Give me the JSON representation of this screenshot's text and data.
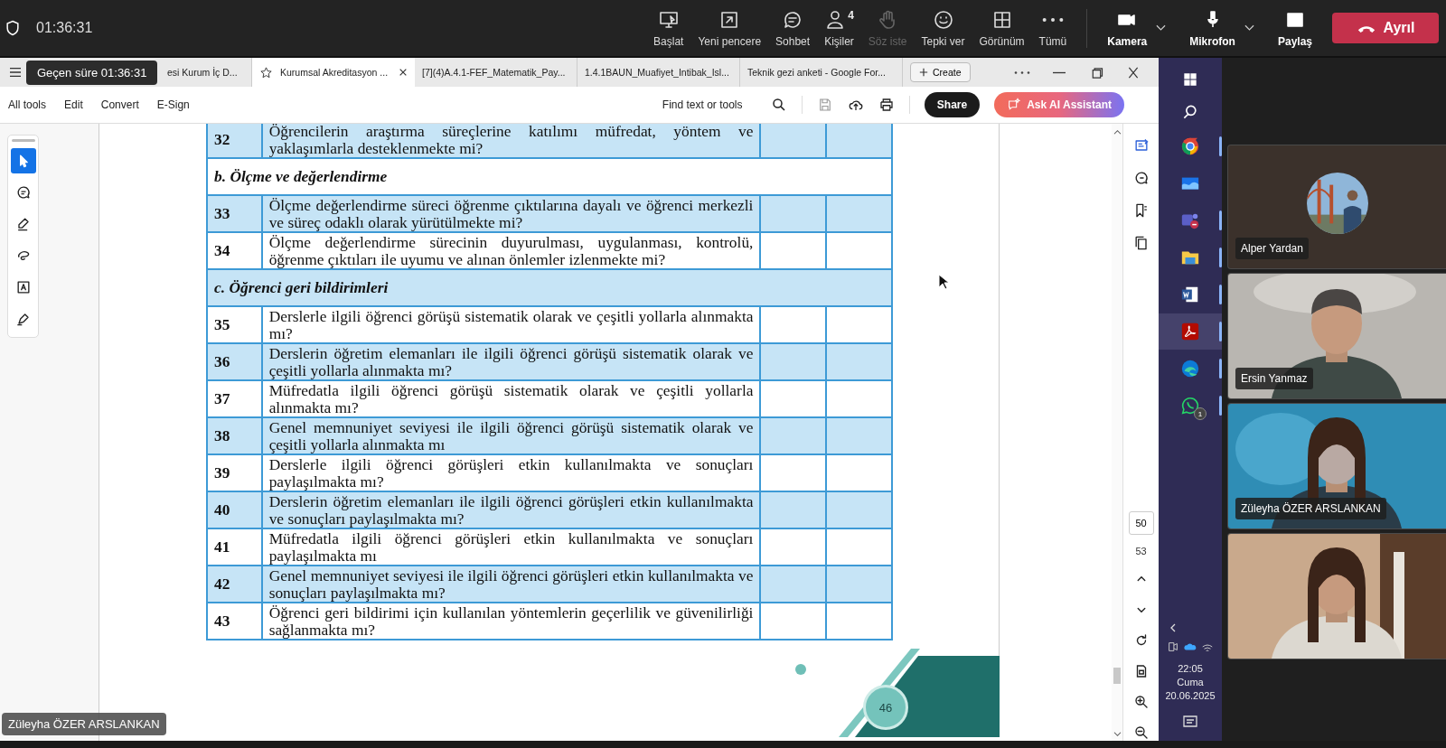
{
  "meeting_bar": {
    "elapsed": "01:36:31",
    "controls": [
      {
        "label": "Başlat",
        "disabled": false
      },
      {
        "label": "Yeni pencere",
        "disabled": false
      },
      {
        "label": "Sohbet",
        "disabled": false
      },
      {
        "label": "Kişiler",
        "count": "4",
        "disabled": false
      },
      {
        "label": "Söz iste",
        "disabled": true
      },
      {
        "label": "Tepki ver",
        "disabled": false
      },
      {
        "label": "Görünüm",
        "disabled": false
      },
      {
        "label": "Tümü",
        "disabled": false
      }
    ],
    "media": [
      {
        "label": "Kamera",
        "dropdown": true
      },
      {
        "label": "Mikrofon",
        "dropdown": true
      },
      {
        "label": "Paylaş",
        "dropdown": false
      }
    ],
    "leave": "Ayrıl"
  },
  "tooltip": "Geçen süre 01:36:31",
  "tabs": [
    {
      "label": "esi Kurum İç D...",
      "selected": false
    },
    {
      "label": "Kurumsal Akreditasyon ...",
      "selected": true
    },
    {
      "label": "[7](4)A.4.1-FEF_Matematik_Pay...",
      "selected": false
    },
    {
      "label": "1.4.1BAUN_Muafiyet_Intibak_Isl...",
      "selected": false
    },
    {
      "label": "Teknik gezi anketi - Google For...",
      "selected": false
    }
  ],
  "create": "Create",
  "menu": [
    "All tools",
    "Edit",
    "Convert",
    "E-Sign"
  ],
  "search": {
    "placeholder": "Find text or tools"
  },
  "share": "Share",
  "ai_assistant": "Ask AI Assistant",
  "tools": [
    {
      "selected": true
    },
    {
      "selected": false
    },
    {
      "selected": false
    },
    {
      "selected": false
    },
    {
      "selected": false
    },
    {
      "selected": false
    }
  ],
  "table": {
    "rows": [
      {
        "kind": "item",
        "number": "32",
        "text": "Öğrencilerin araştırma süreçlerine katılımı müfredat, yöntem ve yaklaşımlarla desteklenmekte mi?",
        "shaded": true
      },
      {
        "kind": "section",
        "text": "b. Ölçme ve değerlendirme",
        "shaded": false
      },
      {
        "kind": "item",
        "number": "33",
        "text": "Ölçme değerlendirme süreci öğrenme çıktılarına dayalı ve öğrenci merkezli ve süreç odaklı olarak yürütülmekte mi?",
        "shaded": true
      },
      {
        "kind": "item",
        "number": "34",
        "text": "Ölçme değerlendirme sürecinin duyurulması, uygulanması, kontrolü, öğrenme çıktıları ile uyumu ve alınan önlemler izlenmekte mi?",
        "shaded": false
      },
      {
        "kind": "section",
        "text": "c. Öğrenci geri bildirimleri",
        "shaded": true
      },
      {
        "kind": "item",
        "number": "35",
        "text": "Derslerle ilgili öğrenci görüşü sistematik olarak ve çeşitli yollarla alınmakta mı?",
        "shaded": false
      },
      {
        "kind": "item",
        "number": "36",
        "text": "Derslerin öğretim elemanları ile ilgili öğrenci görüşü sistematik olarak ve çeşitli yollarla alınmakta mı?",
        "shaded": true
      },
      {
        "kind": "item",
        "number": "37",
        "text": "Müfredatla ilgili öğrenci görüşü sistematik olarak ve çeşitli yollarla alınmakta mı?",
        "shaded": false
      },
      {
        "kind": "item",
        "number": "38",
        "text": "Genel memnuniyet seviyesi ile ilgili öğrenci görüşü sistematik olarak ve çeşitli yollarla alınmakta mı",
        "shaded": true
      },
      {
        "kind": "item",
        "number": "39",
        "text": "Derslerle ilgili öğrenci görüşleri etkin kullanılmakta ve sonuçları paylaşılmakta mı?",
        "shaded": false
      },
      {
        "kind": "item",
        "number": "40",
        "text": "Derslerin öğretim elemanları ile ilgili öğrenci görüşleri etkin kullanılmakta ve sonuçları paylaşılmakta mı?",
        "shaded": true
      },
      {
        "kind": "item",
        "number": "41",
        "text": "Müfredatla ilgili öğrenci görüşleri etkin kullanılmakta ve sonuçları paylaşılmakta mı",
        "shaded": false
      },
      {
        "kind": "item",
        "number": "42",
        "text": "Genel memnuniyet seviyesi ile ilgili öğrenci görüşleri etkin kullanılmakta ve sonuçları paylaşılmakta mı?",
        "shaded": true
      },
      {
        "kind": "item",
        "number": "43",
        "text": "Öğrenci geri bildirimi için kullanılan yöntemlerin geçerlilik ve güvenilirliği sağlanmakta mı?",
        "shaded": false
      }
    ]
  },
  "page_badge": "46",
  "page_nav": {
    "current": "50",
    "total": "53"
  },
  "taskbar": {
    "apps": [
      {
        "selected": false,
        "running": true
      },
      {
        "selected": false,
        "running": false
      },
      {
        "selected": false,
        "running": true
      },
      {
        "selected": false,
        "running": true
      },
      {
        "selected": false,
        "running": true
      },
      {
        "selected": true,
        "running": true
      },
      {
        "selected": false,
        "running": true
      },
      {
        "selected": false,
        "running": true,
        "badge": "1"
      }
    ],
    "time": "22:05",
    "day": "Cuma",
    "date": "20.06.2025"
  },
  "participants": [
    {
      "kind": "avatar",
      "name": "Alper Yardan"
    },
    {
      "kind": "video",
      "name": "Ersin Yanmaz"
    },
    {
      "kind": "video",
      "name": "Züleyha ÖZER ARSLANKAN"
    },
    {
      "kind": "video"
    }
  ],
  "speaker_label": "Züleyha ÖZER ARSLANKAN"
}
